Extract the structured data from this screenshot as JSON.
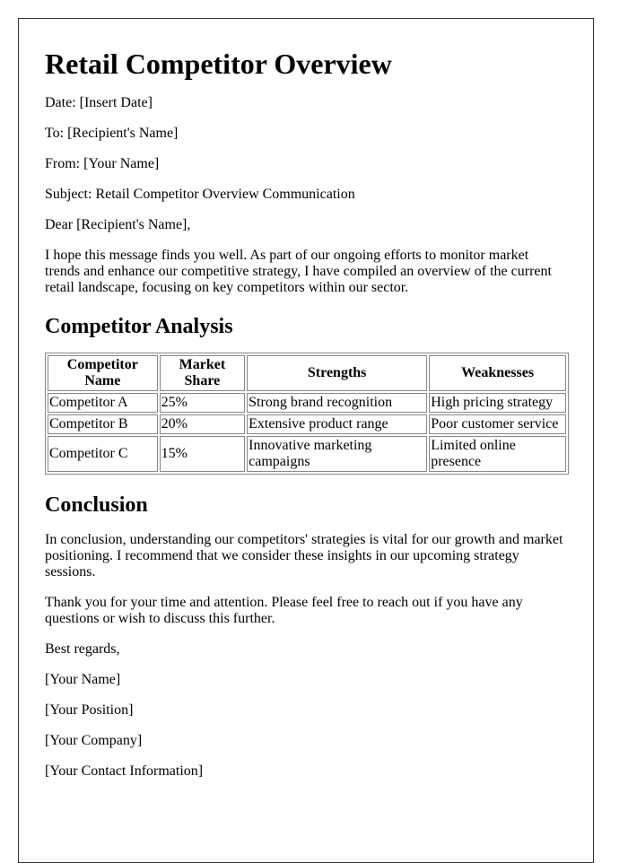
{
  "title": "Retail Competitor Overview",
  "meta": {
    "date": "Date: [Insert Date]",
    "to": "To: [Recipient's Name]",
    "from": "From: [Your Name]",
    "subject": "Subject: Retail Competitor Overview Communication"
  },
  "salutation": "Dear [Recipient's Name],",
  "intro": "I hope this message finds you well. As part of our ongoing efforts to monitor market trends and enhance our competitive strategy, I have compiled an overview of the current retail landscape, focusing on key competitors within our sector.",
  "analysis": {
    "heading": "Competitor Analysis",
    "columns": [
      "Competitor Name",
      "Market Share",
      "Strengths",
      "Weaknesses"
    ],
    "rows": [
      [
        "Competitor A",
        "25%",
        "Strong brand recognition",
        "High pricing strategy"
      ],
      [
        "Competitor B",
        "20%",
        "Extensive product range",
        "Poor customer service"
      ],
      [
        "Competitor C",
        "15%",
        "Innovative marketing campaigns",
        "Limited online presence"
      ]
    ]
  },
  "conclusion": {
    "heading": "Conclusion",
    "paragraph1": "In conclusion, understanding our competitors' strategies is vital for our growth and market positioning. I recommend that we consider these insights in our upcoming strategy sessions.",
    "paragraph2": "Thank you for your time and attention. Please feel free to reach out if you have any questions or wish to discuss this further."
  },
  "signature": {
    "closing": "Best regards,",
    "name": "[Your Name]",
    "position": "[Your Position]",
    "company": "[Your Company]",
    "contact": "[Your Contact Information]"
  }
}
